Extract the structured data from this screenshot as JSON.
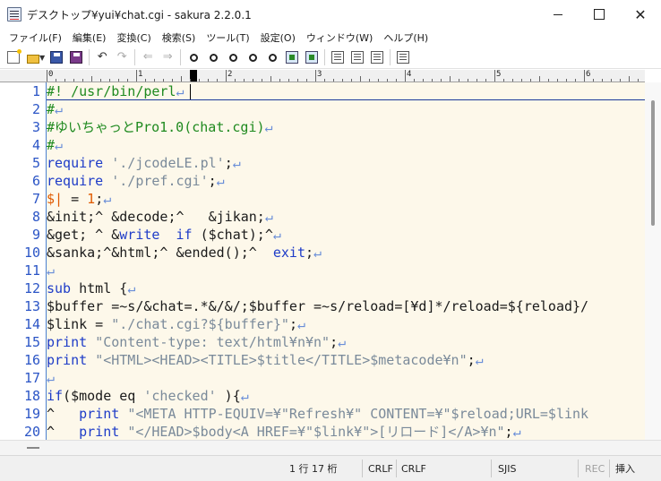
{
  "window": {
    "title": "デスクトップ¥yui¥chat.cgi - sakura 2.2.0.1",
    "minimize_symbol": "",
    "close_symbol": "✕"
  },
  "menu": [
    "ファイル(F)",
    "編集(E)",
    "変換(C)",
    "検索(S)",
    "ツール(T)",
    "設定(O)",
    "ウィンドウ(W)",
    "ヘルプ(H)"
  ],
  "toolbar": {
    "undo_glyph": "↶",
    "redo_glyph": "↷",
    "prev_glyph": "⇐",
    "next_glyph": "⇒",
    "find_glyph": "⚲",
    "dropdown_glyph": "▼"
  },
  "ruler": {
    "labels": [
      "0",
      "1",
      "2",
      "3",
      "4",
      "5",
      "6"
    ]
  },
  "lines": [
    {
      "num": "1",
      "segs": [
        {
          "t": "#! /usr/bin/perl",
          "c": "c-comment"
        },
        {
          "t": "↵",
          "c": "c-ret"
        }
      ]
    },
    {
      "num": "2",
      "segs": [
        {
          "t": "#",
          "c": "c-comment"
        },
        {
          "t": "↵",
          "c": "c-ret"
        }
      ]
    },
    {
      "num": "3",
      "segs": [
        {
          "t": "#ゆいちゃっとPro1.0(chat.cgi)",
          "c": "c-comment"
        },
        {
          "t": "↵",
          "c": "c-ret"
        }
      ]
    },
    {
      "num": "4",
      "segs": [
        {
          "t": "#",
          "c": "c-comment"
        },
        {
          "t": "↵",
          "c": "c-ret"
        }
      ]
    },
    {
      "num": "5",
      "segs": [
        {
          "t": "require",
          "c": "c-kw"
        },
        {
          "t": " ",
          "c": ""
        },
        {
          "t": "'./jcodeLE.pl'",
          "c": "c-str"
        },
        {
          "t": ";",
          "c": ""
        },
        {
          "t": "↵",
          "c": "c-ret"
        }
      ]
    },
    {
      "num": "6",
      "segs": [
        {
          "t": "require",
          "c": "c-kw"
        },
        {
          "t": " ",
          "c": ""
        },
        {
          "t": "'./pref.cgi'",
          "c": "c-str"
        },
        {
          "t": ";",
          "c": ""
        },
        {
          "t": "↵",
          "c": "c-ret"
        }
      ]
    },
    {
      "num": "7",
      "segs": [
        {
          "t": "$|",
          "c": "c-var"
        },
        {
          "t": " = ",
          "c": ""
        },
        {
          "t": "1",
          "c": "c-var"
        },
        {
          "t": ";",
          "c": ""
        },
        {
          "t": "↵",
          "c": "c-ret"
        }
      ]
    },
    {
      "num": "8",
      "segs": [
        {
          "t": "&init;^ &decode;^   &jikan;",
          "c": ""
        },
        {
          "t": "↵",
          "c": "c-ret"
        }
      ]
    },
    {
      "num": "9",
      "segs": [
        {
          "t": "&get; ^ &",
          "c": ""
        },
        {
          "t": "write",
          "c": "c-kw"
        },
        {
          "t": "  ",
          "c": ""
        },
        {
          "t": "if",
          "c": "c-kw"
        },
        {
          "t": " ($chat);^",
          "c": ""
        },
        {
          "t": "↵",
          "c": "c-ret"
        }
      ]
    },
    {
      "num": "10",
      "segs": [
        {
          "t": "&sanka;^&html;^ &ended();^  ",
          "c": ""
        },
        {
          "t": "exit",
          "c": "c-kw"
        },
        {
          "t": ";",
          "c": ""
        },
        {
          "t": "↵",
          "c": "c-ret"
        }
      ]
    },
    {
      "num": "11",
      "segs": [
        {
          "t": "↵",
          "c": "c-ret"
        }
      ]
    },
    {
      "num": "12",
      "segs": [
        {
          "t": "sub",
          "c": "c-kw"
        },
        {
          "t": " html {",
          "c": ""
        },
        {
          "t": "↵",
          "c": "c-ret"
        }
      ]
    },
    {
      "num": "13",
      "segs": [
        {
          "t": "$buffer =~s/&chat=.*&/&/;$buffer =~s/reload=[¥d]*/reload=${reload}/",
          "c": ""
        }
      ]
    },
    {
      "num": "14",
      "segs": [
        {
          "t": "$link = ",
          "c": ""
        },
        {
          "t": "\"./chat.cgi?${buffer}\"",
          "c": "c-str"
        },
        {
          "t": ";",
          "c": ""
        },
        {
          "t": "↵",
          "c": "c-ret"
        }
      ]
    },
    {
      "num": "15",
      "segs": [
        {
          "t": "print",
          "c": "c-kw"
        },
        {
          "t": " ",
          "c": ""
        },
        {
          "t": "\"Content-type: text/html¥n¥n\"",
          "c": "c-str"
        },
        {
          "t": ";",
          "c": ""
        },
        {
          "t": "↵",
          "c": "c-ret"
        }
      ]
    },
    {
      "num": "16",
      "segs": [
        {
          "t": "print",
          "c": "c-kw"
        },
        {
          "t": " ",
          "c": ""
        },
        {
          "t": "\"<HTML><HEAD><TITLE>$title</TITLE>$metacode¥n\"",
          "c": "c-str"
        },
        {
          "t": ";",
          "c": ""
        },
        {
          "t": "↵",
          "c": "c-ret"
        }
      ]
    },
    {
      "num": "17",
      "segs": [
        {
          "t": "↵",
          "c": "c-ret"
        }
      ]
    },
    {
      "num": "18",
      "segs": [
        {
          "t": "if",
          "c": "c-kw"
        },
        {
          "t": "($mode eq ",
          "c": ""
        },
        {
          "t": "'checked'",
          "c": "c-str"
        },
        {
          "t": " ){",
          "c": ""
        },
        {
          "t": "↵",
          "c": "c-ret"
        }
      ]
    },
    {
      "num": "19",
      "segs": [
        {
          "t": "^   ",
          "c": ""
        },
        {
          "t": "print",
          "c": "c-kw"
        },
        {
          "t": " ",
          "c": ""
        },
        {
          "t": "\"<META HTTP-EQUIV=¥\"Refresh¥\" CONTENT=¥\"$reload;URL=$link",
          "c": "c-str"
        }
      ]
    },
    {
      "num": "20",
      "segs": [
        {
          "t": "^   ",
          "c": ""
        },
        {
          "t": "print",
          "c": "c-kw"
        },
        {
          "t": " ",
          "c": ""
        },
        {
          "t": "\"</HEAD>$body<A HREF=¥\"$link¥\">[リロード]</A>¥n\"",
          "c": "c-str"
        },
        {
          "t": ";",
          "c": ""
        },
        {
          "t": "↵",
          "c": "c-ret"
        }
      ]
    }
  ],
  "status": {
    "position": "1 行  17 桁",
    "newline_1": "CRLF",
    "newline_2": "CRLF",
    "encoding": "SJIS",
    "rec": "REC",
    "insert_mode": "挿入"
  }
}
